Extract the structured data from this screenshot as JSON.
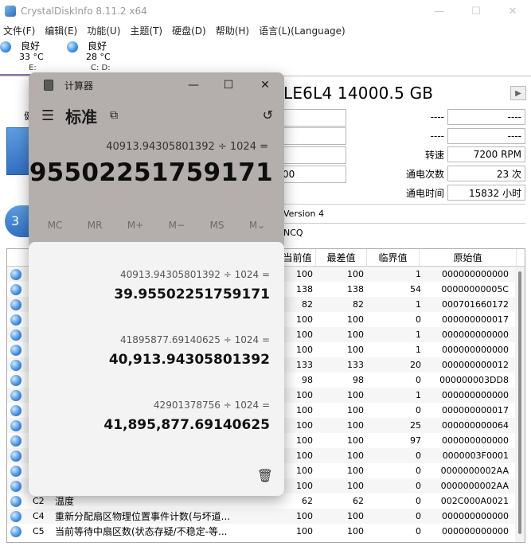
{
  "cdi": {
    "title": "CrystalDiskInfo 8.11.2 x64",
    "window_controls": [
      "—",
      "☐",
      "✕"
    ],
    "menu": [
      "文件(F)",
      "编辑(E)",
      "功能(U)",
      "主题(T)",
      "硬盘(D)",
      "帮助(H)",
      "语言(L)(Language)"
    ],
    "drives": [
      {
        "status": "良好",
        "temp": "33 °C",
        "letter": "E:"
      },
      {
        "status": "良好",
        "temp": "28 °C",
        "letter": "C: D:"
      }
    ],
    "model": "LE6L4 14000.5 GB",
    "next_icon": "▶",
    "health_label_partial": "健",
    "temp_partial": "3",
    "left_boxes": [
      "",
      "",
      "00",
      ""
    ],
    "right_info": {
      "blank1": "----",
      "blank1_right": "----",
      "blank2": "----",
      "blank2_right": "----",
      "rotation_label": "转速",
      "rotation_value": "7200 RPM",
      "power_count_label": "通电次数",
      "power_count_value": "23 次",
      "power_time_label": "通电时间",
      "power_time_value": "15832 小时"
    },
    "version": "Version 4",
    "features": "NCQ"
  },
  "smart": {
    "headers": [
      "当前值",
      "最差值",
      "临界值",
      "原始值"
    ],
    "rows": [
      {
        "id": "",
        "name": "",
        "cur": "100",
        "worst": "100",
        "thr": "1",
        "raw": "000000000000"
      },
      {
        "id": "",
        "name": "",
        "cur": "138",
        "worst": "138",
        "thr": "54",
        "raw": "00000000005C"
      },
      {
        "id": "",
        "name": "",
        "cur": "82",
        "worst": "82",
        "thr": "1",
        "raw": "000701660172"
      },
      {
        "id": "",
        "name": "",
        "cur": "100",
        "worst": "100",
        "thr": "0",
        "raw": "000000000017"
      },
      {
        "id": "",
        "name": "",
        "cur": "100",
        "worst": "100",
        "thr": "1",
        "raw": "000000000000"
      },
      {
        "id": "",
        "name": "",
        "cur": "100",
        "worst": "100",
        "thr": "1",
        "raw": "000000000000"
      },
      {
        "id": "",
        "name": "",
        "cur": "133",
        "worst": "133",
        "thr": "20",
        "raw": "000000000012"
      },
      {
        "id": "",
        "name": "",
        "cur": "98",
        "worst": "98",
        "thr": "0",
        "raw": "000000003DD8"
      },
      {
        "id": "",
        "name": "",
        "cur": "100",
        "worst": "100",
        "thr": "1",
        "raw": "000000000000"
      },
      {
        "id": "",
        "name": "",
        "cur": "100",
        "worst": "100",
        "thr": "0",
        "raw": "000000000017"
      },
      {
        "id": "",
        "name": "",
        "cur": "100",
        "worst": "100",
        "thr": "25",
        "raw": "000000000064"
      },
      {
        "id": "",
        "name": "",
        "cur": "100",
        "worst": "100",
        "thr": "97",
        "raw": "000000000000"
      },
      {
        "id": "",
        "name": "",
        "cur": "100",
        "worst": "100",
        "thr": "0",
        "raw": "0000003F0001"
      },
      {
        "id": "",
        "name": "",
        "cur": "100",
        "worst": "100",
        "thr": "0",
        "raw": "0000000002AA"
      },
      {
        "id": "",
        "name": "",
        "cur": "100",
        "worst": "100",
        "thr": "0",
        "raw": "0000000002AA"
      },
      {
        "id": "C2",
        "name": "温度",
        "cur": "62",
        "worst": "62",
        "thr": "0",
        "raw": "002C000A0021"
      },
      {
        "id": "C4",
        "name": "重新分配扇区物理位置事件计数(与坏道...",
        "cur": "100",
        "worst": "100",
        "thr": "0",
        "raw": "000000000000"
      },
      {
        "id": "C5",
        "name": "当前等待中扇区数(状态存疑/不稳定-等...",
        "cur": "100",
        "worst": "100",
        "thr": "0",
        "raw": "000000000000"
      }
    ]
  },
  "calc": {
    "title": "计算器",
    "window_controls": [
      "—",
      "☐",
      "✕"
    ],
    "mode": "标准",
    "menu_icon": "☰",
    "keep_on_top_icon": "⧉",
    "history_icon": "↺",
    "expression": "40913.94305801392 ÷ 1024 =",
    "result": "39.95502251759171",
    "memory": [
      "MC",
      "MR",
      "M+",
      "M−",
      "MS",
      "M⌄"
    ],
    "history": [
      {
        "expr": "40913.94305801392   ÷   1024 =",
        "result": "39.95502251759171"
      },
      {
        "expr": "41895877.69140625   ÷   1024 =",
        "result": "40,913.94305801392"
      },
      {
        "expr": "42901378756   ÷   1024 =",
        "result": "41,895,877.69140625"
      }
    ],
    "trash_icon": "🗑"
  }
}
